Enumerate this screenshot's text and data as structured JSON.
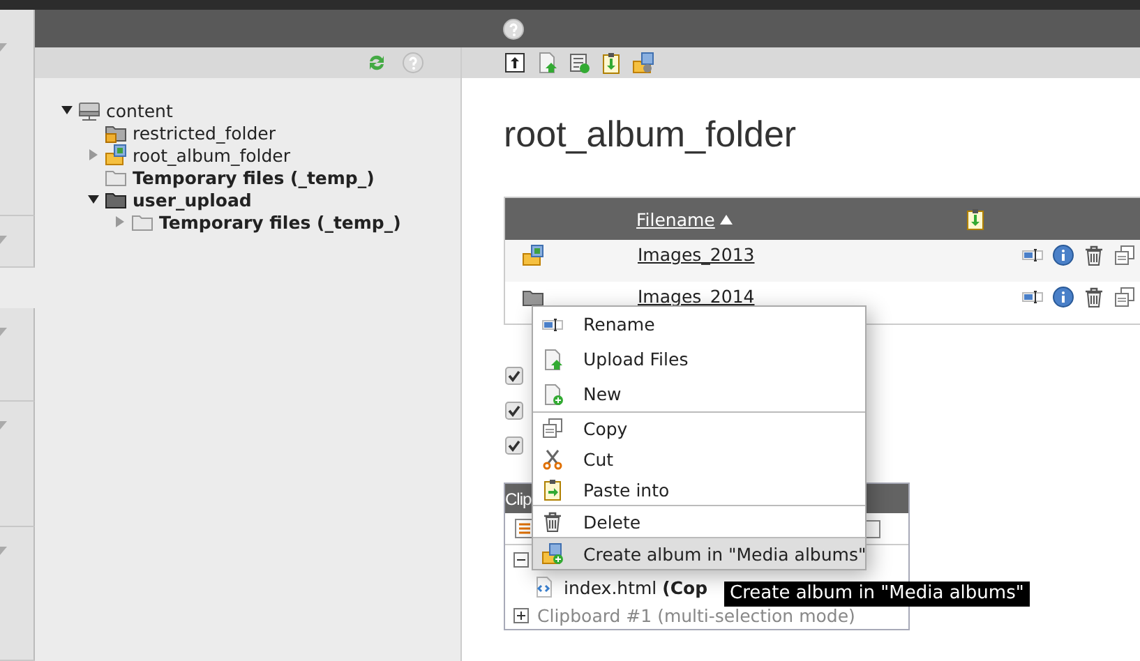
{
  "tree": [
    {
      "label": "content",
      "kind": "storage",
      "expanded": true,
      "children": [
        {
          "label": "restricted_folder",
          "kind": "locked-folder"
        },
        {
          "label": "root_album_folder",
          "kind": "album-folder",
          "expanded": false
        },
        {
          "label": "Temporary files (_temp_)",
          "kind": "temp-folder"
        },
        {
          "label": "user_upload",
          "kind": "mount-folder",
          "expanded": true,
          "children": [
            {
              "label": "Temporary files (_temp_)",
              "kind": "temp-folder",
              "expanded": false
            }
          ]
        }
      ]
    }
  ],
  "page_title": "root_album_folder",
  "table": {
    "columns": [
      {
        "label": "Filename",
        "sorted": true
      }
    ],
    "rows": [
      {
        "name": "Images_2013",
        "kind": "album-folder"
      },
      {
        "name": "Images_2014",
        "kind": "folder"
      }
    ]
  },
  "checkboxes": [
    {
      "checked": true
    },
    {
      "checked": true
    },
    {
      "checked": true
    }
  ],
  "clipboard": {
    "title": "Clip",
    "panes": [
      {
        "expanded": true,
        "entries": [
          "index.html **(Cop**"
        ]
      },
      {
        "expanded": false,
        "label": "Clipboard #1 (multi-selection mode)"
      }
    ]
  },
  "context_menu": {
    "groups": [
      [
        {
          "label": "Rename",
          "kind": "rename",
          "selected": false
        },
        {
          "label": "Upload Files",
          "kind": "upload",
          "selected": false
        },
        {
          "label": "New",
          "kind": "new",
          "selected": false
        }
      ],
      [
        {
          "label": "Copy",
          "kind": "copy",
          "selected": false
        },
        {
          "label": "Cut",
          "kind": "cut",
          "selected": false
        },
        {
          "label": "Paste into",
          "kind": "paste",
          "selected": false
        }
      ],
      [
        {
          "label": "Delete",
          "kind": "delete",
          "selected": false
        }
      ],
      [
        {
          "label": "Create album in \"Media albums\"",
          "kind": "album-create",
          "selected": true
        }
      ]
    ]
  },
  "tooltip": "Create album in \"Media albums\""
}
